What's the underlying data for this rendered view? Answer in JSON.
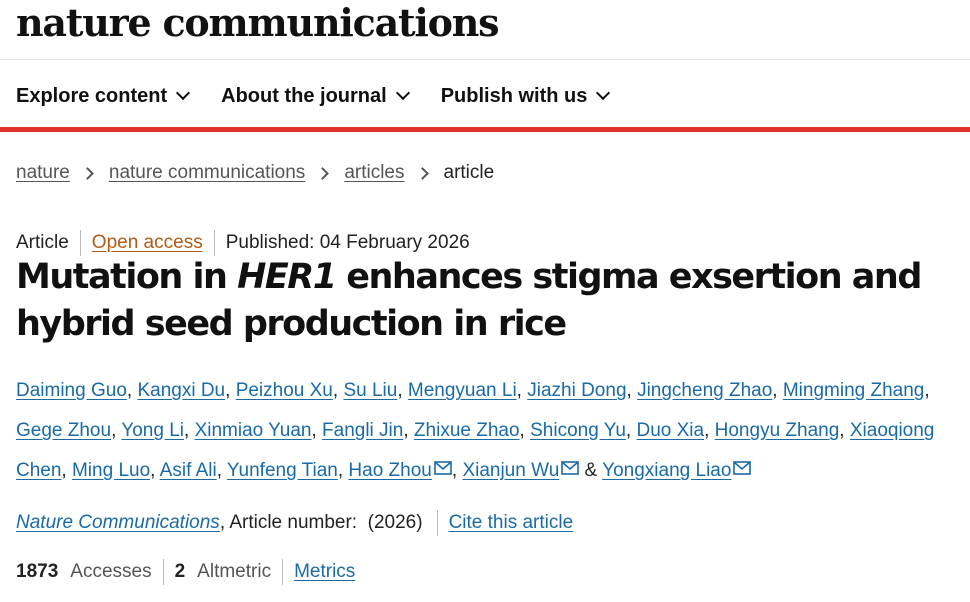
{
  "brand": "nature communications",
  "nav": {
    "items": [
      {
        "label": "Explore content",
        "icon": "chevron-down-icon"
      },
      {
        "label": "About the journal",
        "icon": "chevron-down-icon"
      },
      {
        "label": "Publish with us",
        "icon": "chevron-down-icon"
      }
    ]
  },
  "breadcrumb": {
    "items": [
      "nature",
      "nature communications",
      "articles"
    ],
    "current": "article"
  },
  "article": {
    "type": "Article",
    "access": "Open access",
    "published": "Published: 04 February 2026",
    "title_before": "Mutation in ",
    "title_gene": "HER1",
    "title_after": " enhances stigma exsertion and hybrid seed production in rice",
    "authors": [
      "Daiming Guo",
      "Kangxi Du",
      "Peizhou Xu",
      "Su Liu",
      "Mengyuan Li",
      "Jiazhi Dong",
      "Jingcheng Zhao",
      "Mingming Zhang",
      "Gege Zhou",
      "Yong Li",
      "Xinmiao Yuan",
      "Fangli Jin",
      "Zhixue Zhao",
      "Shicong Yu",
      "Duo Xia",
      "Hongyu Zhang",
      "Xiaoqiong Chen",
      "Ming Luo",
      "Asif Ali",
      "Yunfeng Tian",
      "Hao Zhou",
      "Xianjun Wu",
      "Yongxiang Liao"
    ],
    "corresponding_authors": [
      "Hao Zhou",
      "Xianjun Wu",
      "Yongxiang Liao"
    ],
    "and_symbol": "&",
    "journal": "Nature Communications",
    "article_number": ", Article number:  (2026)",
    "cite_label": "Cite this article",
    "accesses_value": "1873",
    "accesses_label": "Accesses",
    "altmetric_value": "2",
    "altmetric_label": "Altmetric",
    "metrics_label": "Metrics"
  },
  "colors": {
    "accent_red": "#e0332c",
    "link_blue": "#1a6aa6",
    "open_access_orange": "#b35a17"
  }
}
